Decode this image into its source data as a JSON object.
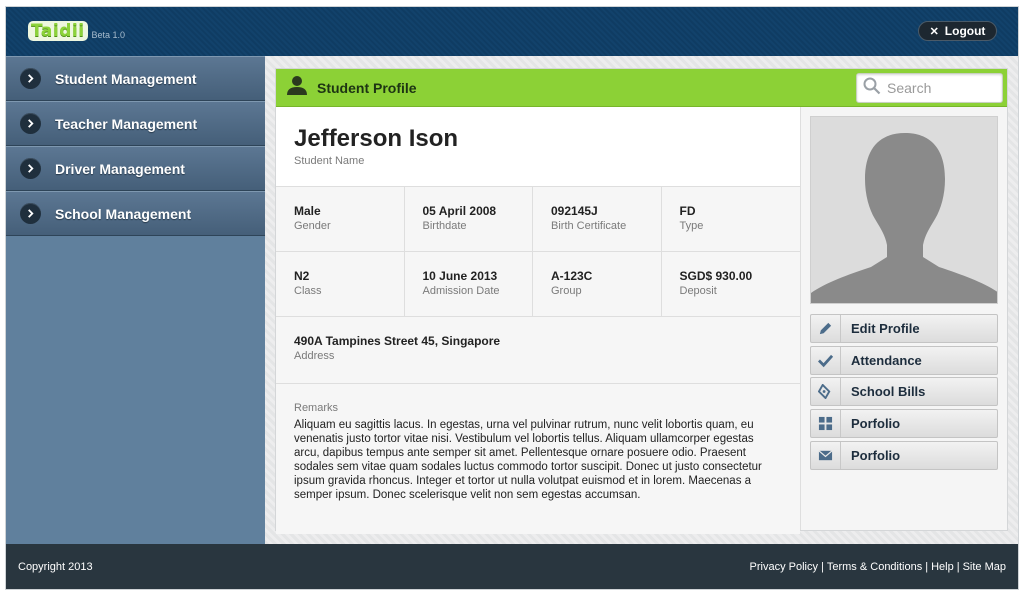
{
  "header": {
    "logo_text": "Taidii",
    "beta_label": "Beta 1.0",
    "logout_label": "Logout"
  },
  "sidebar": {
    "items": [
      {
        "label": "Student Management"
      },
      {
        "label": "Teacher Management"
      },
      {
        "label": "Driver Management"
      },
      {
        "label": "School Management"
      }
    ]
  },
  "panel": {
    "title": "Student Profile",
    "search_placeholder": "Search"
  },
  "student": {
    "name": "Jefferson Ison",
    "name_label": "Student Name",
    "fields": [
      {
        "value": "Male",
        "label": "Gender"
      },
      {
        "value": "05 April 2008",
        "label": "Birthdate"
      },
      {
        "value": "092145J",
        "label": "Birth Certificate"
      },
      {
        "value": "FD",
        "label": "Type"
      },
      {
        "value": "N2",
        "label": "Class"
      },
      {
        "value": "10 June 2013",
        "label": "Admission Date"
      },
      {
        "value": "A-123C",
        "label": "Group"
      },
      {
        "value": "SGD$ 930.00",
        "label": "Deposit"
      }
    ],
    "address": "490A Tampines Street 45, Singapore",
    "address_label": "Address",
    "remarks_label": "Remarks",
    "remarks": "Aliquam eu sagittis lacus. In egestas, urna vel pulvinar rutrum, nunc velit lobortis quam, eu venenatis justo tortor vitae nisi. Vestibulum vel lobortis tellus. Aliquam ullamcorper egestas arcu, dapibus tempus ante semper sit amet. Pellentesque ornare posuere odio. Praesent sodales sem vitae quam sodales luctus commodo tortor suscipit. Donec ut justo consectetur ipsum gravida rhoncus. Integer et tortor ut nulla volutpat euismod et in lorem. Maecenas a semper ipsum. Donec scelerisque velit non sem egestas accumsan."
  },
  "actions": [
    {
      "label": "Edit Profile",
      "icon": "pencil-icon"
    },
    {
      "label": "Attendance",
      "icon": "checkmark-icon"
    },
    {
      "label": "School Bills",
      "icon": "bills-icon"
    },
    {
      "label": "Porfolio",
      "icon": "grid-icon"
    },
    {
      "label": "Porfolio",
      "icon": "envelope-icon"
    }
  ],
  "footer": {
    "copyright": "Copyright 2013",
    "links": [
      "Privacy Policy",
      "Terms & Conditions",
      "Help",
      "Site Map"
    ]
  },
  "colors": {
    "topbar": "#0f3c63",
    "sidebar": "#60809d",
    "accent_green": "#8cd136",
    "footer": "#29363f"
  }
}
